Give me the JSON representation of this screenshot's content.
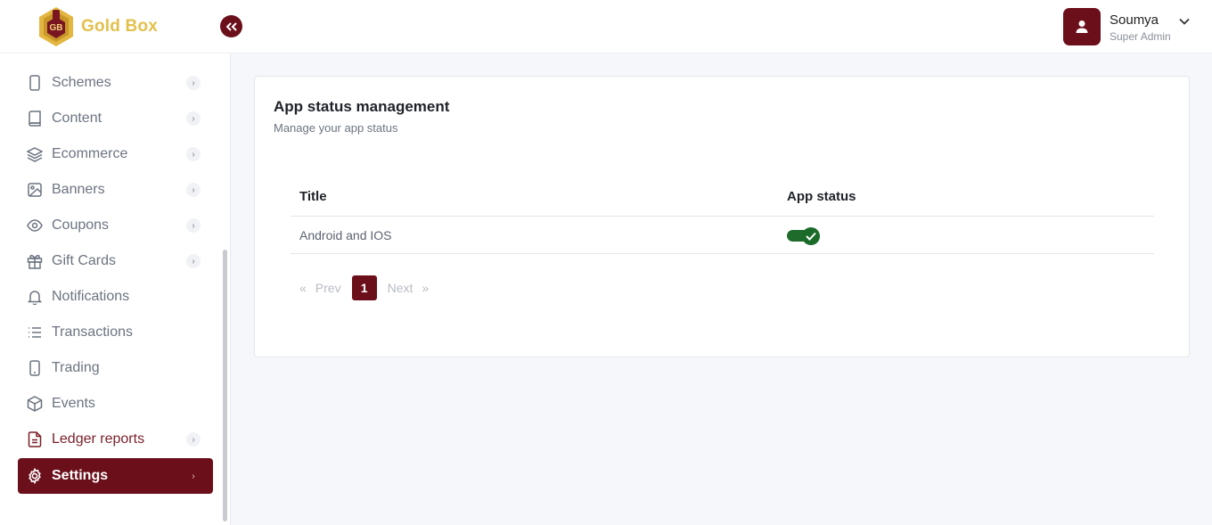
{
  "brand": {
    "name": "Gold Box",
    "logo_text": "GB"
  },
  "sidebar": {
    "items": [
      {
        "label": "Schemes",
        "icon": "tablet-icon",
        "has_chevron": true
      },
      {
        "label": "Content",
        "icon": "book-icon",
        "has_chevron": true
      },
      {
        "label": "Ecommerce",
        "icon": "layers-icon",
        "has_chevron": true
      },
      {
        "label": "Banners",
        "icon": "image-icon",
        "has_chevron": true
      },
      {
        "label": "Coupons",
        "icon": "eye-icon",
        "has_chevron": true
      },
      {
        "label": "Gift Cards",
        "icon": "gift-icon",
        "has_chevron": true
      },
      {
        "label": "Notifications",
        "icon": "bell-icon",
        "has_chevron": false
      },
      {
        "label": "Transactions",
        "icon": "list-icon",
        "has_chevron": false
      },
      {
        "label": "Trading",
        "icon": "phone-icon",
        "has_chevron": false
      },
      {
        "label": "Events",
        "icon": "box-icon",
        "has_chevron": false
      },
      {
        "label": "Ledger reports",
        "icon": "file-text-icon",
        "has_chevron": true
      },
      {
        "label": "Settings",
        "icon": "gear-icon",
        "has_chevron": true,
        "active": true
      }
    ]
  },
  "header": {
    "user_name": "Soumya",
    "user_role": "Super Admin"
  },
  "main": {
    "title": "App status management",
    "subtitle": "Manage your app status",
    "table": {
      "columns": [
        "Title",
        "App status"
      ],
      "rows": [
        {
          "title": "Android and IOS",
          "app_status": true
        }
      ]
    },
    "pagination": {
      "first": "«",
      "prev": "Prev",
      "current": "1",
      "next": "Next",
      "last": "»"
    }
  },
  "colors": {
    "brand_maroon": "#6b0f1a",
    "brand_gold": "#e3c04c",
    "toggle_on": "#1a6b2a"
  }
}
